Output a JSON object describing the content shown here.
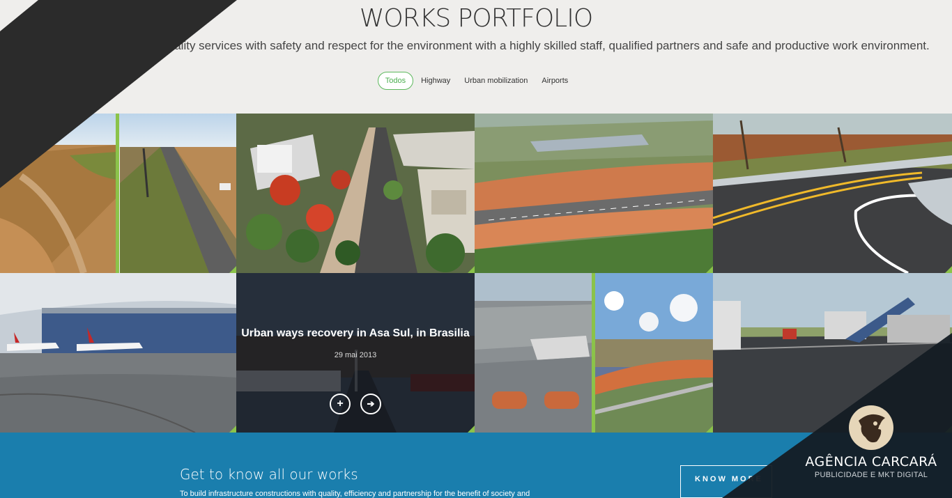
{
  "header": {
    "title": "WORKS PORTFOLIO",
    "subtitle": "EPC policy is to offer high quality services with safety and respect for the environment with a highly skilled staff, qualified partners and safe and productive work environment."
  },
  "filters": [
    {
      "label": "Todos",
      "active": true
    },
    {
      "label": "Highway",
      "active": false
    },
    {
      "label": "Urban mobilization",
      "active": false
    },
    {
      "label": "Airports",
      "active": false
    }
  ],
  "hover_tile": {
    "title": "Urban ways recovery in Asa Sul, in Brasilia",
    "date": "29 mai 2013",
    "plus_icon": "+",
    "arrow_icon": "➔"
  },
  "footer": {
    "title": "Get to know all our works",
    "text": "To build infrastructure constructions with quality, efficiency and partnership for the benefit of society and",
    "button": "KNOW MORE"
  },
  "agency": {
    "name": "AGÊNCIA CARCARÁ",
    "tagline": "PUBLICIDADE E MKT DIGITAL"
  },
  "colors": {
    "accent_green": "#8bc34a",
    "footer_blue": "#1a7ead",
    "page_bg": "#efeeec"
  }
}
